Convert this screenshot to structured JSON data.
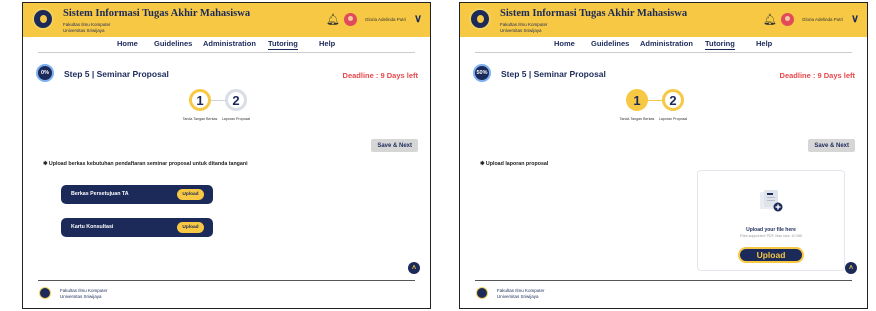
{
  "header": {
    "app_title": "Sistem Informasi Tugas Akhir Mahasiswa",
    "org_line1": "Fakultas Ilmu Komputer",
    "org_line2": "Universitas Sriwijaya",
    "user_name": "Gloria Adelinda Putri",
    "bell_icon": "bell-icon",
    "chevron_icon": "chevron-down-icon"
  },
  "nav": [
    "Home",
    "Guidelines",
    "Administration",
    "Tutoring",
    "Help"
  ],
  "nav_active": "Tutoring",
  "colors": {
    "accent": "#f7c843",
    "navy": "#1c2a5a",
    "deadline": "#e8484c"
  },
  "stepper": {
    "steps": [
      "1",
      "2"
    ],
    "labels": [
      "Tanda Tangan Berkas",
      "Laporan Proposal"
    ]
  },
  "left": {
    "progress_text": "0%",
    "progress": 0,
    "step_title": "Step 5 | Seminar Proposal",
    "deadline": "Deadline : 9 Days left",
    "save_label": "Save & Next",
    "section_label": "✱ Upload berkas kebutuhan pendaftaran seminar proposal untuk ditanda tangani",
    "cards": [
      {
        "label": "Berkas Persetujuan TA",
        "button": "Upload"
      },
      {
        "label": "Kartu Konsultasi",
        "button": "Upload"
      }
    ]
  },
  "right": {
    "progress_text": "50%",
    "progress": 0.5,
    "step_title": "Step 5 | Seminar Proposal",
    "deadline": "Deadline : 9 Days left",
    "save_label": "Save & Next",
    "section_label": "✱ Upload laporan proposal",
    "dropzone_heading": "Upload your file here",
    "dropzone_sub": "Files supported: PDF, Max size: 10 MB",
    "upload_button": "Upload"
  },
  "footer": {
    "line1": "Fakultas Ilmu Komputer",
    "line2": "Universitas Sriwijaya"
  }
}
